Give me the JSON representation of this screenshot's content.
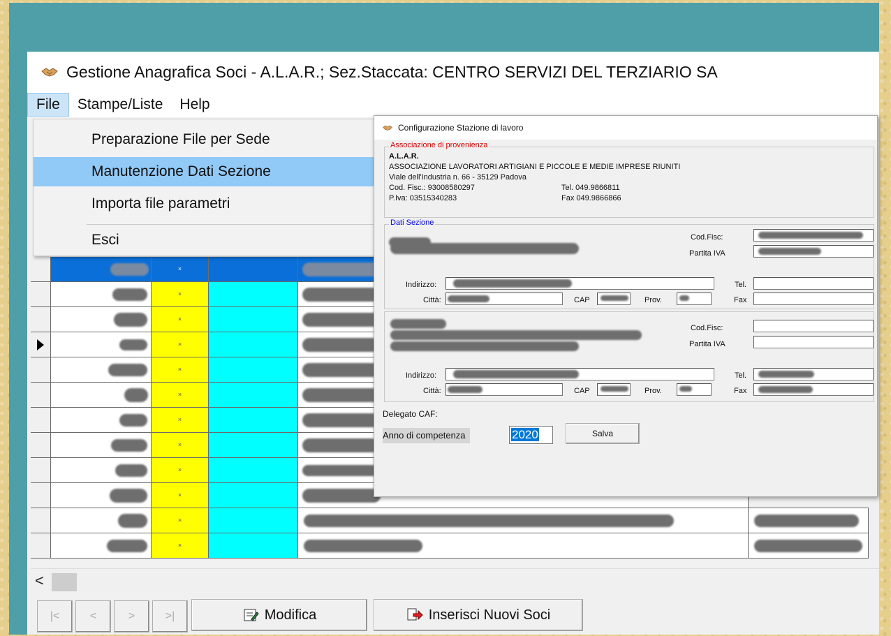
{
  "window": {
    "title": "Gestione Anagrafica Soci - A.L.A.R.; Sez.Staccata: CENTRO SERVIZI DEL TERZIARIO SA"
  },
  "menubar": {
    "file": "File",
    "stampe": "Stampe/Liste",
    "help": "Help"
  },
  "file_menu": {
    "items": [
      "Preparazione File per Sede",
      "Manutenzione Dati Sezione",
      "Importa file parametri",
      "Esci"
    ],
    "highlighted": "Manutenzione Dati Sezione"
  },
  "grid": {
    "flag_text": "×",
    "row_count": 12,
    "selected_row": 1,
    "pointer_row": 4
  },
  "nav": {
    "first": "|<",
    "prev": "<",
    "next": ">",
    "last": ">|",
    "modifica": "Modifica",
    "inserisci": "Inserisci Nuovi Soci",
    "scroll_left": "<"
  },
  "dialog": {
    "title": "Configurazione Stazione di lavoro",
    "association": {
      "legend": "Associazione di provenienza",
      "name": "A.L.A.R.",
      "full_name": "ASSOCIAZIONE LAVORATORI ARTIGIANI E PICCOLE E MEDIE IMPRESE RIUNITI",
      "address": "Viale dell'Industria n. 66 - 35129 Padova",
      "cod_fisc": "Cod. Fisc.: 93008580297",
      "tel": "Tel. 049.9866811",
      "piva": "P.Iva: 03515340283",
      "fax": "Fax 049.9866866"
    },
    "sezione": {
      "legend": "Dati Sezione",
      "cod_fisc_label": "Cod.Fisc:",
      "piva_label": "Partita IVA",
      "indirizzo_label": "Indirizzo:",
      "tel_label": "Tel.",
      "citta_label": "Città:",
      "cap_label": "CAP",
      "prov_label": "Prov.",
      "fax_label": "Fax"
    },
    "delegato_label": "Delegato CAF:",
    "anno_label": "Anno di competenza",
    "anno_value": "2020",
    "salva": "Salva"
  },
  "colors": {
    "desktop": "#4f9fa8",
    "selection": "#0a6fd8",
    "flag_column": "#ffff00",
    "cyan_column": "#00ffff",
    "menu_highlight": "#91c9f7",
    "legend_red": "#e00000",
    "legend_blue": "#0000ff"
  }
}
